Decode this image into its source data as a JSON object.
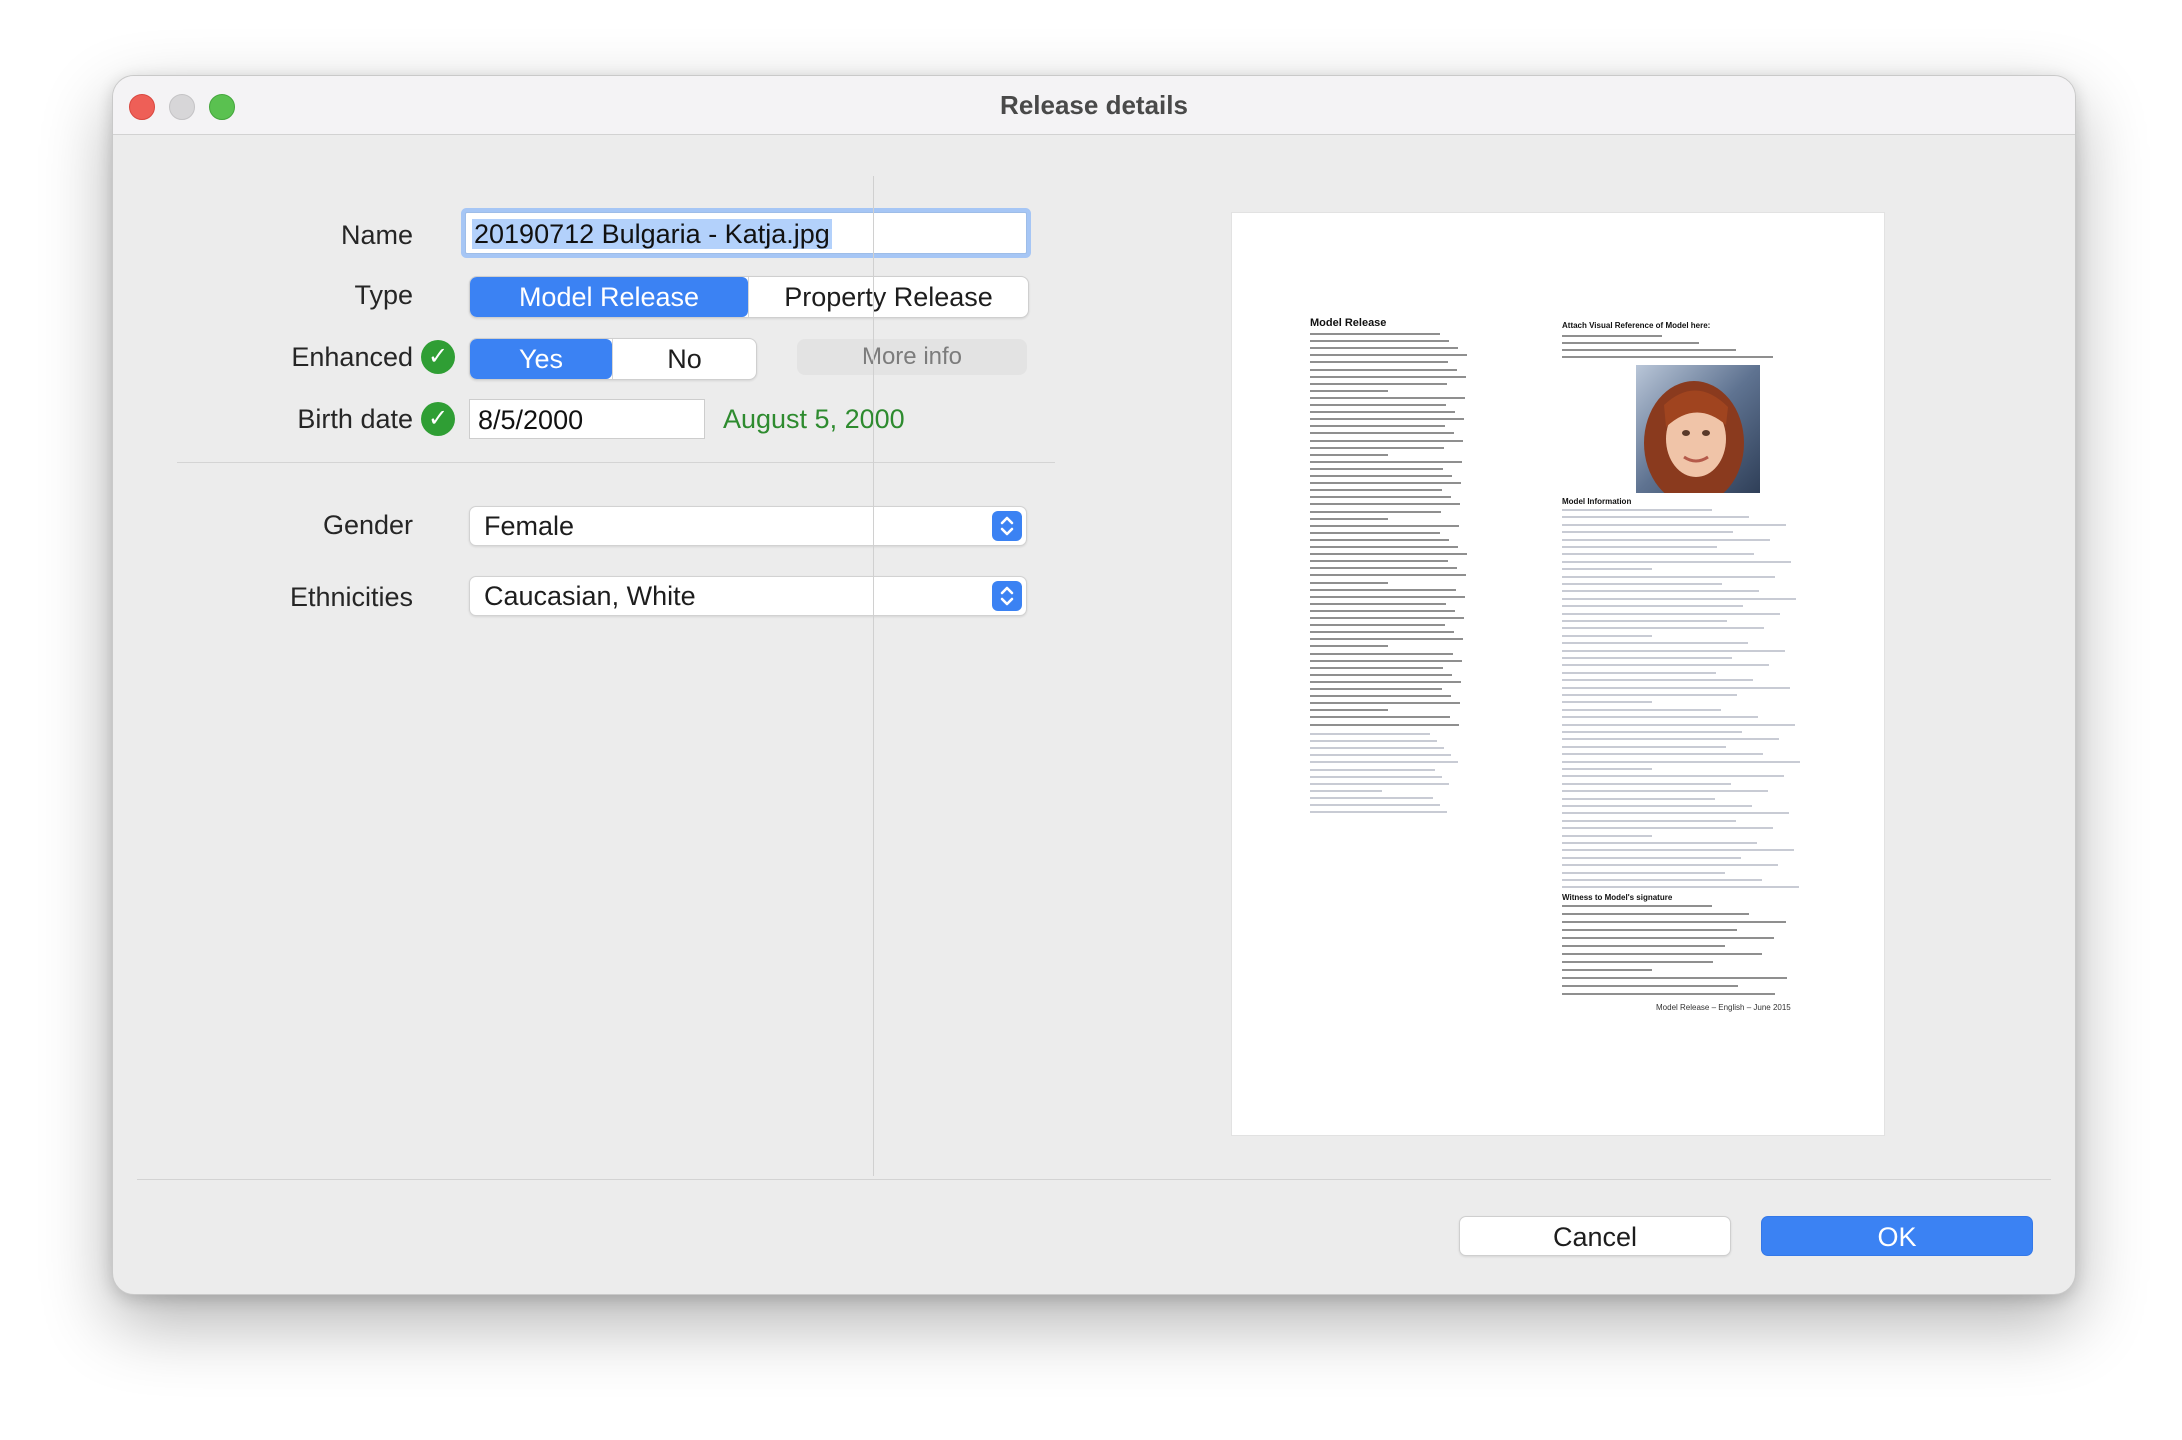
{
  "window": {
    "title": "Release details"
  },
  "form": {
    "name": {
      "label": "Name",
      "value": "20190712 Bulgaria - Katja.jpg"
    },
    "type": {
      "label": "Type",
      "options": [
        "Model Release",
        "Property Release"
      ],
      "selected": "Model Release"
    },
    "enhanced": {
      "label": "Enhanced",
      "options": [
        "Yes",
        "No"
      ],
      "selected": "Yes",
      "more_info": "More info"
    },
    "birth_date": {
      "label": "Birth date",
      "value": "8/5/2000",
      "readout": "August 5, 2000"
    },
    "gender": {
      "label": "Gender",
      "value": "Female"
    },
    "ethnicities": {
      "label": "Ethnicities",
      "value": "Caucasian, White"
    }
  },
  "preview": {
    "doc_title": "Model Release",
    "attach_title": "Attach Visual Reference of Model here:",
    "model_info_title": "Model Information",
    "witness_title": "Witness to Model's signature",
    "footer": "Model Release – English – June 2015"
  },
  "buttons": {
    "cancel": "Cancel",
    "ok": "OK"
  },
  "colors": {
    "accent": "#3b82f3",
    "success": "#2e8b2f"
  }
}
